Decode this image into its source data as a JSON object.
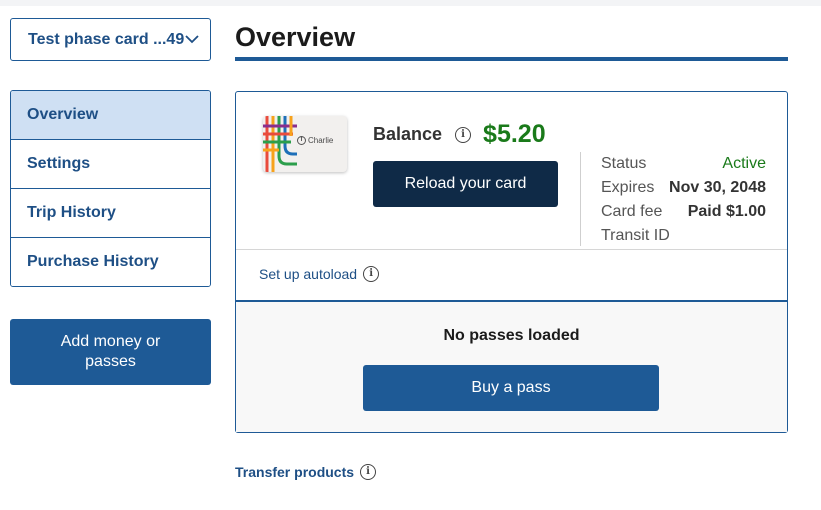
{
  "card_selector": {
    "label": "Test phase card ...49",
    "icon": "chevron-down-icon"
  },
  "sidebar": {
    "items": [
      {
        "label": "Overview",
        "active": true
      },
      {
        "label": "Settings",
        "active": false
      },
      {
        "label": "Trip History",
        "active": false
      },
      {
        "label": "Purchase History",
        "active": false
      }
    ],
    "add_money_label": "Add money or passes"
  },
  "main": {
    "title": "Overview",
    "card": {
      "image_label": "Charlie",
      "balance_label": "Balance",
      "balance_amount": "$5.20",
      "reload_label": "Reload your card",
      "details": [
        {
          "key": "Status",
          "value": "Active"
        },
        {
          "key": "Expires",
          "value": "Nov 30, 2048"
        },
        {
          "key": "Card fee",
          "value": "Paid $1.00"
        },
        {
          "key": "Transit ID",
          "value": ""
        }
      ],
      "autoload_label": "Set up autoload"
    },
    "passes": {
      "empty_text": "No passes loaded",
      "buy_label": "Buy a pass"
    },
    "transfer_label": "Transfer products"
  },
  "colors": {
    "brand_blue": "#1e5a96",
    "dark_navy": "#0f2a47",
    "active_green": "#1a7a1a",
    "nav_active_bg": "#cfe0f3"
  }
}
